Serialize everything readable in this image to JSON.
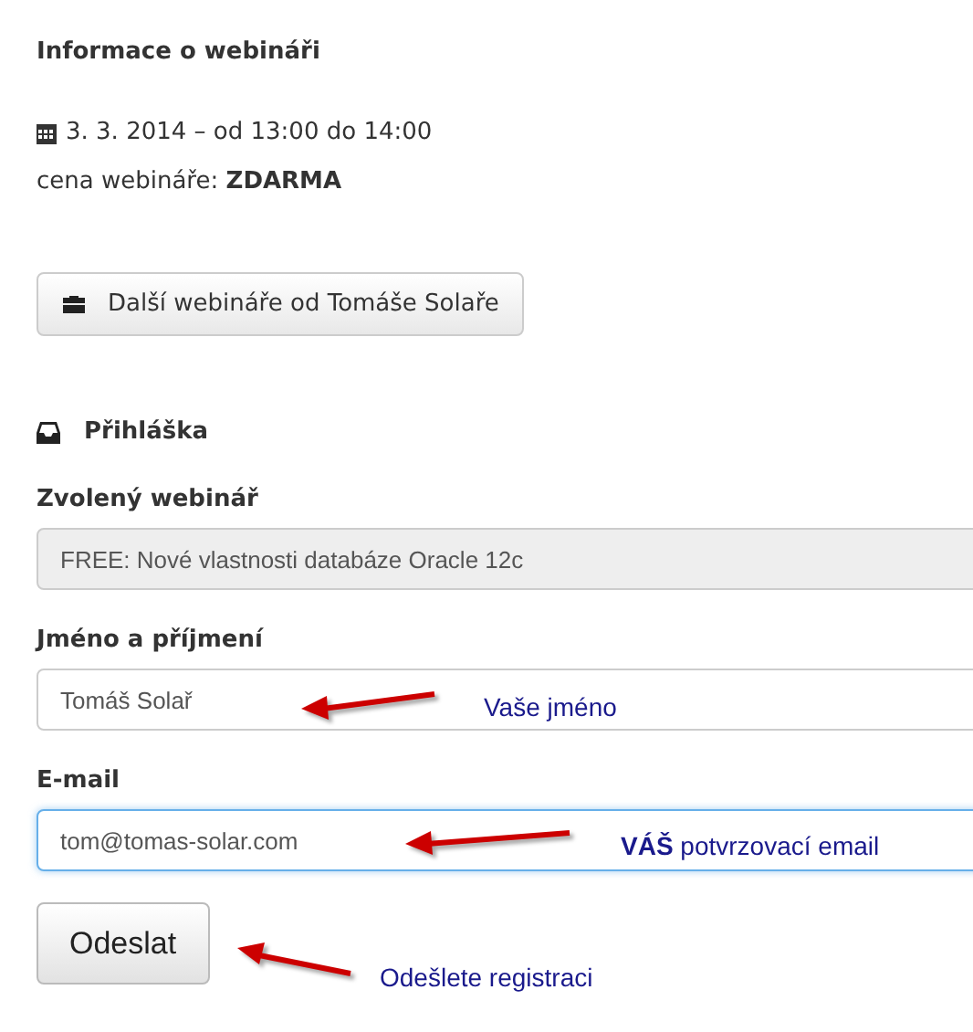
{
  "heading": "Informace o webináři",
  "date": "3. 3. 2014 – od 13:00 do 14:00",
  "price": "cena webináře: **ZDARMA**",
  "more_button": "Další webináře od Tomáše Solaře",
  "form_title": "Přihláška",
  "fields": [
    {
      "label": "Zvolený webinář",
      "value": "FREE: Nové vlastnosti databáze Oracle 12c",
      "disabled": true,
      "focused": false
    },
    {
      "label": "Jméno a příjmení",
      "value": "Tomáš Solař",
      "disabled": false,
      "focused": false
    },
    {
      "label": "E-mail",
      "value": "tom@tomas-solar.com",
      "disabled": false,
      "focused": true
    }
  ],
  "submit_button": "Odeslat",
  "annotations": [
    {
      "text": "Vaše jméno"
    },
    {
      "text": "**VÁŠ** potvrzovací email"
    },
    {
      "text": "Odešlete registraci"
    }
  ]
}
